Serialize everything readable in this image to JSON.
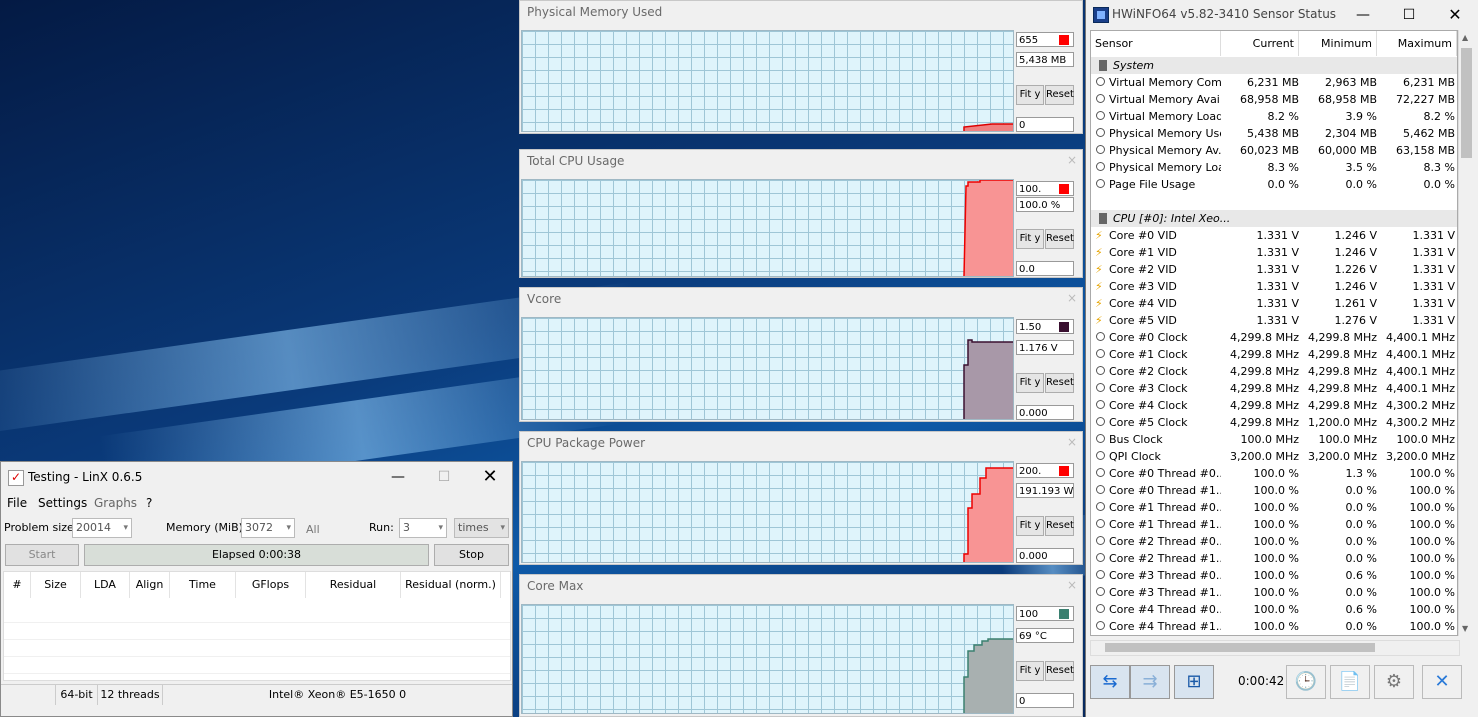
{
  "graphs": [
    {
      "title": "Physical Memory Used",
      "max": "655",
      "current": "5,438 MB",
      "min": "0",
      "fit_label": "Fit y",
      "reset_label": "Reset",
      "color": "#ff0000",
      "fill": "#f08080"
    },
    {
      "title": "Total CPU Usage",
      "max": "100.",
      "current": "100.0 %",
      "min": "0.0",
      "fit_label": "Fit y",
      "reset_label": "Reset",
      "color": "#ff0000",
      "fill": "#f89494"
    },
    {
      "title": "Vcore",
      "max": "1.50",
      "current": "1.176 V",
      "min": "0.000",
      "fit_label": "Fit y",
      "reset_label": "Reset",
      "color": "#3a1030",
      "fill": "#a898a8"
    },
    {
      "title": "CPU Package Power",
      "max": "200.",
      "current": "191.193 W",
      "min": "0.000",
      "fit_label": "Fit y",
      "reset_label": "Reset",
      "color": "#ff0000",
      "fill": "#f89494"
    },
    {
      "title": "Core Max",
      "max": "100",
      "current": "69 °C",
      "min": "0",
      "fit_label": "Fit y",
      "reset_label": "Reset",
      "color": "#3a8070",
      "fill": "#a8b0b0"
    }
  ],
  "linx": {
    "title": "Testing - LinX 0.6.5",
    "menu": [
      "File",
      "Settings",
      "Graphs",
      "?"
    ],
    "problem_size_label": "Problem size:",
    "problem_size_value": "20014",
    "memory_label": "Memory (MiB):",
    "memory_value": "3072",
    "all_label": "All",
    "run_label": "Run:",
    "run_value": "3",
    "times_value": "times",
    "start_label": "Start",
    "elapsed": "Elapsed 0:00:38",
    "stop_label": "Stop",
    "columns": [
      "#",
      "Size",
      "LDA",
      "Align",
      "Time",
      "GFlops",
      "Residual",
      "Residual (norm.)"
    ],
    "status": [
      "64-bit",
      "12 threads",
      "Intel® Xeon® E5-1650 0"
    ]
  },
  "hwinfo": {
    "title": "HWiNFO64 v5.82-3410 Sensor Status",
    "columns": [
      "Sensor",
      "Current",
      "Minimum",
      "Maximum"
    ],
    "rows": [
      {
        "group": true,
        "name": "System"
      },
      {
        "name": "Virtual Memory Com...",
        "cur": "6,231 MB",
        "min": "2,963 MB",
        "max": "6,231 MB"
      },
      {
        "name": "Virtual Memory Avai...",
        "cur": "68,958 MB",
        "min": "68,958 MB",
        "max": "72,227 MB"
      },
      {
        "name": "Virtual Memory Load",
        "cur": "8.2 %",
        "min": "3.9 %",
        "max": "8.2 %"
      },
      {
        "name": "Physical Memory Used",
        "cur": "5,438 MB",
        "min": "2,304 MB",
        "max": "5,462 MB"
      },
      {
        "name": "Physical Memory Av...",
        "cur": "60,023 MB",
        "min": "60,000 MB",
        "max": "63,158 MB"
      },
      {
        "name": "Physical Memory Load",
        "cur": "8.3 %",
        "min": "3.5 %",
        "max": "8.3 %"
      },
      {
        "name": "Page File Usage",
        "cur": "0.0 %",
        "min": "0.0 %",
        "max": "0.0 %"
      },
      {
        "blank": true
      },
      {
        "group": true,
        "name": "CPU [#0]: Intel Xeo..."
      },
      {
        "bolt": true,
        "name": "Core #0 VID",
        "cur": "1.331 V",
        "min": "1.246 V",
        "max": "1.331 V"
      },
      {
        "bolt": true,
        "name": "Core #1 VID",
        "cur": "1.331 V",
        "min": "1.246 V",
        "max": "1.331 V"
      },
      {
        "bolt": true,
        "name": "Core #2 VID",
        "cur": "1.331 V",
        "min": "1.226 V",
        "max": "1.331 V"
      },
      {
        "bolt": true,
        "name": "Core #3 VID",
        "cur": "1.331 V",
        "min": "1.246 V",
        "max": "1.331 V"
      },
      {
        "bolt": true,
        "name": "Core #4 VID",
        "cur": "1.331 V",
        "min": "1.261 V",
        "max": "1.331 V"
      },
      {
        "bolt": true,
        "name": "Core #5 VID",
        "cur": "1.331 V",
        "min": "1.276 V",
        "max": "1.331 V"
      },
      {
        "name": "Core #0 Clock",
        "cur": "4,299.8 MHz",
        "min": "4,299.8 MHz",
        "max": "4,400.1 MHz"
      },
      {
        "name": "Core #1 Clock",
        "cur": "4,299.8 MHz",
        "min": "4,299.8 MHz",
        "max": "4,400.1 MHz"
      },
      {
        "name": "Core #2 Clock",
        "cur": "4,299.8 MHz",
        "min": "4,299.8 MHz",
        "max": "4,400.1 MHz"
      },
      {
        "name": "Core #3 Clock",
        "cur": "4,299.8 MHz",
        "min": "4,299.8 MHz",
        "max": "4,400.1 MHz"
      },
      {
        "name": "Core #4 Clock",
        "cur": "4,299.8 MHz",
        "min": "4,299.8 MHz",
        "max": "4,300.2 MHz"
      },
      {
        "name": "Core #5 Clock",
        "cur": "4,299.8 MHz",
        "min": "1,200.0 MHz",
        "max": "4,300.2 MHz"
      },
      {
        "name": "Bus Clock",
        "cur": "100.0 MHz",
        "min": "100.0 MHz",
        "max": "100.0 MHz"
      },
      {
        "name": "QPI Clock",
        "cur": "3,200.0 MHz",
        "min": "3,200.0 MHz",
        "max": "3,200.0 MHz"
      },
      {
        "name": "Core #0 Thread #0...",
        "cur": "100.0 %",
        "min": "1.3 %",
        "max": "100.0 %"
      },
      {
        "name": "Core #0 Thread #1...",
        "cur": "100.0 %",
        "min": "0.0 %",
        "max": "100.0 %"
      },
      {
        "name": "Core #1 Thread #0...",
        "cur": "100.0 %",
        "min": "0.0 %",
        "max": "100.0 %"
      },
      {
        "name": "Core #1 Thread #1...",
        "cur": "100.0 %",
        "min": "0.0 %",
        "max": "100.0 %"
      },
      {
        "name": "Core #2 Thread #0...",
        "cur": "100.0 %",
        "min": "0.0 %",
        "max": "100.0 %"
      },
      {
        "name": "Core #2 Thread #1...",
        "cur": "100.0 %",
        "min": "0.0 %",
        "max": "100.0 %"
      },
      {
        "name": "Core #3 Thread #0...",
        "cur": "100.0 %",
        "min": "0.6 %",
        "max": "100.0 %"
      },
      {
        "name": "Core #3 Thread #1...",
        "cur": "100.0 %",
        "min": "0.0 %",
        "max": "100.0 %"
      },
      {
        "name": "Core #4 Thread #0...",
        "cur": "100.0 %",
        "min": "0.6 %",
        "max": "100.0 %"
      },
      {
        "name": "Core #4 Thread #1...",
        "cur": "100.0 %",
        "min": "0.0 %",
        "max": "100.0 %"
      }
    ],
    "timer": "0:00:42"
  }
}
